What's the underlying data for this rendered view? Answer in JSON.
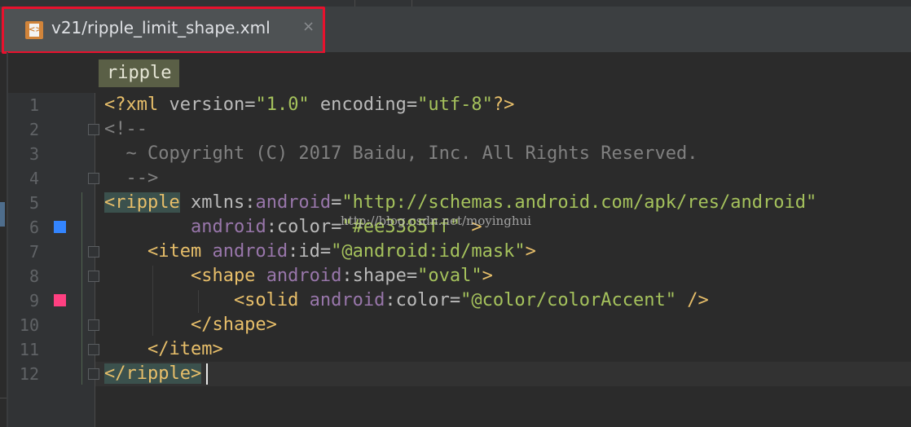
{
  "tab": {
    "title": "v21/ripple_limit_shape.xml",
    "close_glyph": "×",
    "file_icon": "xml-file-icon",
    "highlight_color": "#e8112d"
  },
  "breadcrumb": {
    "label": "ripple"
  },
  "editor": {
    "lines": [
      {
        "n": "1",
        "segs": [
          [
            "t-punct",
            "<?"
          ],
          [
            "t-tag",
            "xml "
          ],
          [
            "t-attr",
            "version"
          ],
          [
            "t-attr",
            "="
          ],
          [
            "t-val",
            "\"1.0\""
          ],
          [
            "t-attr",
            " encoding"
          ],
          [
            "t-attr",
            "="
          ],
          [
            "t-val",
            "\"utf-8\""
          ],
          [
            "t-punct",
            "?>"
          ]
        ]
      },
      {
        "n": "2",
        "segs": [
          [
            "t-com",
            "<!--"
          ]
        ]
      },
      {
        "n": "3",
        "segs": [
          [
            "t-com",
            "  ~ Copyright (C) 2017 Baidu, Inc. All Rights Reserved."
          ]
        ]
      },
      {
        "n": "4",
        "segs": [
          [
            "t-com",
            "  -->"
          ]
        ]
      },
      {
        "n": "5",
        "segs": [
          [
            "t-tag hl",
            "<ripple"
          ],
          [
            "t-attr",
            " xmlns"
          ],
          [
            "t-attr",
            ":"
          ],
          [
            "t-ns",
            "android"
          ],
          [
            "t-attr",
            "="
          ],
          [
            "t-val",
            "\"http://schemas.android.com/apk/res/android\""
          ]
        ]
      },
      {
        "n": "6",
        "segs": [
          [
            "t-attr",
            "        "
          ],
          [
            "t-ns",
            "android"
          ],
          [
            "t-attr",
            ":color="
          ],
          [
            "t-val",
            "\"#ee3385ff\""
          ],
          [
            "t-tag",
            " >"
          ]
        ]
      },
      {
        "n": "7",
        "segs": [
          [
            "t-tag",
            "    <item "
          ],
          [
            "t-ns",
            "android"
          ],
          [
            "t-attr",
            ":id="
          ],
          [
            "t-val",
            "\"@android:id/mask\""
          ],
          [
            "t-tag",
            ">"
          ]
        ]
      },
      {
        "n": "8",
        "segs": [
          [
            "t-tag",
            "        <shape "
          ],
          [
            "t-ns",
            "android"
          ],
          [
            "t-attr",
            ":shape="
          ],
          [
            "t-val",
            "\"oval\""
          ],
          [
            "t-tag",
            ">"
          ]
        ]
      },
      {
        "n": "9",
        "segs": [
          [
            "t-tag",
            "            <solid "
          ],
          [
            "t-ns",
            "android"
          ],
          [
            "t-attr",
            ":color="
          ],
          [
            "t-val",
            "\"@color/colorAccent\""
          ],
          [
            "t-tag",
            " />"
          ]
        ]
      },
      {
        "n": "10",
        "segs": [
          [
            "t-tag",
            "        </shape>"
          ]
        ]
      },
      {
        "n": "11",
        "segs": [
          [
            "t-tag",
            "    </item>"
          ]
        ]
      },
      {
        "n": "12",
        "segs": [
          [
            "t-tag hl",
            "</ripple>"
          ]
        ]
      }
    ],
    "gutter_swatches": [
      {
        "line": "6",
        "color": "#3385ff"
      },
      {
        "line": "9",
        "color": "#ff4081"
      }
    ],
    "watermark": "http://blog.csdn.net/moyinghui"
  }
}
